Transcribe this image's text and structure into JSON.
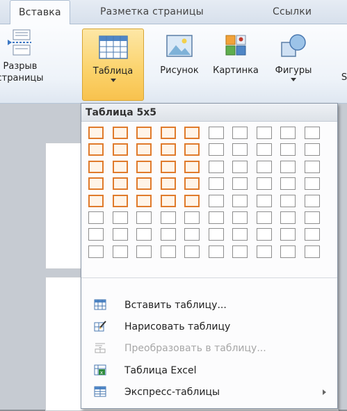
{
  "tabs": {
    "insert": "Вставка",
    "page_layout": "Разметка страницы",
    "references": "Ссылки"
  },
  "ribbon": {
    "page_break": {
      "line1": "Разрыв",
      "line2": "страницы"
    },
    "table": "Таблица",
    "picture": "Рисунок",
    "clipart": "Картинка",
    "shapes": "Фигуры",
    "partial": "S"
  },
  "menu": {
    "header": "Таблица 5x5",
    "grid": {
      "columns": 10,
      "rows": 8,
      "selected_columns": 5,
      "selected_rows": 5
    },
    "items": [
      {
        "label": "Вставить таблицу...",
        "icon": "insert-table-icon",
        "enabled": true,
        "submenu": false
      },
      {
        "label": "Нарисовать таблицу",
        "icon": "draw-table-icon",
        "enabled": true,
        "submenu": false
      },
      {
        "label": "Преобразовать в таблицу...",
        "icon": "convert-table-icon",
        "enabled": false,
        "submenu": false
      },
      {
        "label": "Таблица Excel",
        "icon": "excel-table-icon",
        "enabled": true,
        "submenu": false
      },
      {
        "label": "Экспресс-таблицы",
        "icon": "quick-tables-icon",
        "enabled": true,
        "submenu": true
      }
    ]
  },
  "colors": {
    "highlight_border": "#e07b2c",
    "selected_button": "#fbd26a",
    "accent_blue": "#2b6cb3"
  }
}
